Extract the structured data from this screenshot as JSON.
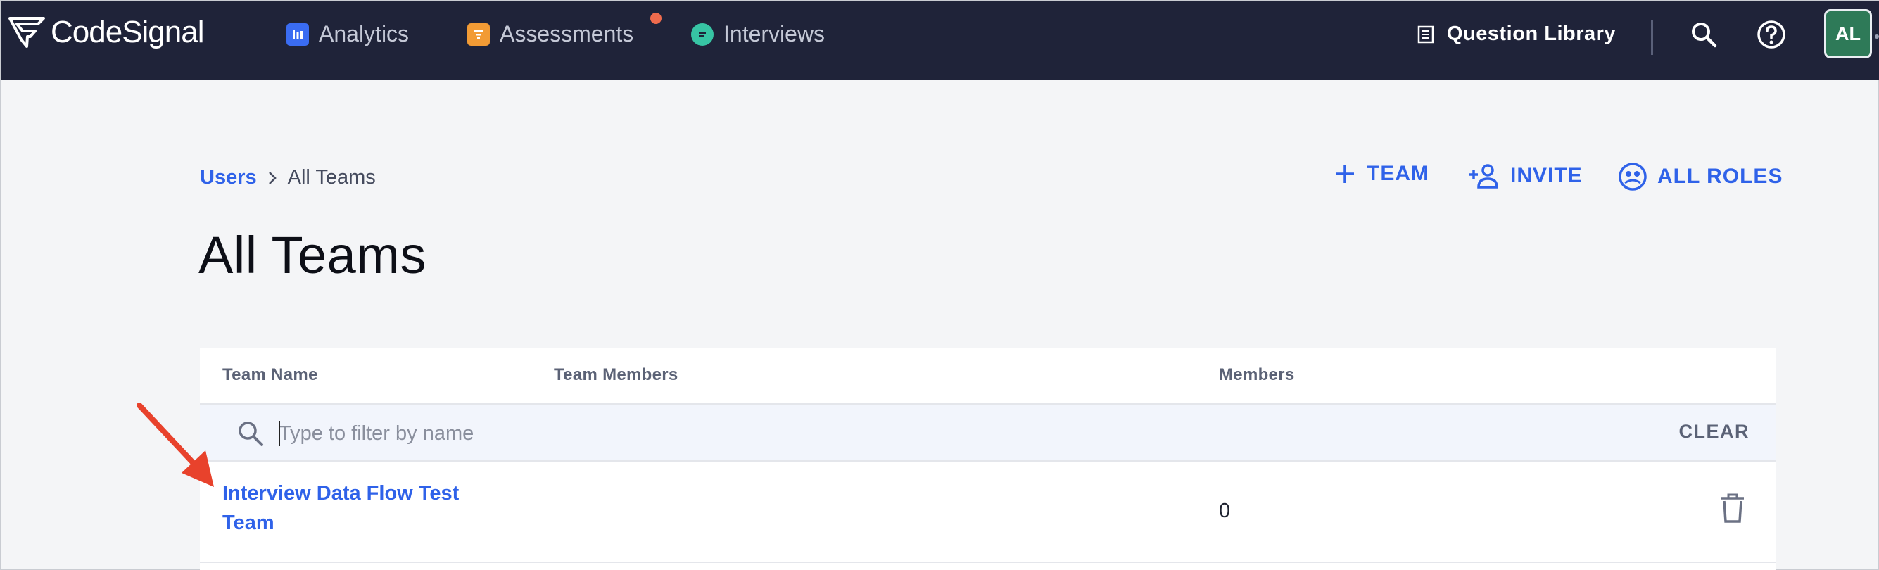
{
  "nav": {
    "brand": "CodeSignal",
    "items": [
      {
        "label": "Analytics",
        "icon": "analytics-icon",
        "color": "#3a6cf2"
      },
      {
        "label": "Assessments",
        "icon": "assessments-icon",
        "color": "#f29b35",
        "has_notification": true
      },
      {
        "label": "Interviews",
        "icon": "interviews-icon",
        "color": "#37c4a4"
      }
    ],
    "question_library": "Question Library",
    "avatar_initials": "AL"
  },
  "breadcrumb": {
    "parent": "Users",
    "current": "All Teams"
  },
  "page_title": "All Teams",
  "actions": {
    "team": "TEAM",
    "invite": "INVITE",
    "all_roles": "ALL ROLES"
  },
  "table": {
    "columns": [
      "Team Name",
      "Team Members",
      "Members"
    ],
    "filter_placeholder": "Type to filter by name",
    "clear_label": "CLEAR",
    "rows": [
      {
        "team_name": "Interview Data Flow Test Team",
        "team_members": "",
        "members": "0"
      }
    ]
  },
  "colors": {
    "accent": "#2f62e9",
    "nav_bg": "#1f2339",
    "annotation_arrow": "#e8422c"
  }
}
